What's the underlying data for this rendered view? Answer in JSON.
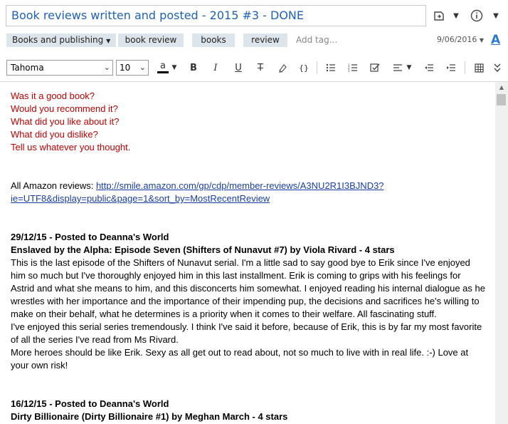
{
  "note": {
    "title": "Book reviews written and posted - 2015 #3 - DONE"
  },
  "header_icons": {
    "reminder": "reminder-icon",
    "info": "info-icon",
    "more": "more-icon"
  },
  "tags_bar": {
    "notebook": "Books and publishing",
    "tags": [
      "book review",
      "books",
      "review"
    ],
    "add_tag_placeholder": "Add tag...",
    "date": "9/06/2016",
    "font_icon": "A"
  },
  "toolbar": {
    "font": "Tahoma",
    "size": "10",
    "text_color_label": "a",
    "bold": "B",
    "italic": "I",
    "underline": "U",
    "strike": "T",
    "highlight_icon": "highlighter-icon",
    "code": "{}",
    "bullets_icon": "bulleted-list-icon",
    "numbered_icon": "numbered-list-icon",
    "checkbox_icon": "checkbox-icon",
    "align_icon": "align-icon",
    "outdent_icon": "outdent-icon",
    "indent_icon": "indent-icon",
    "table_icon": "table-icon",
    "expand_icon": "expand-chevron-icon"
  },
  "content": {
    "questions": [
      "Was it a good book?",
      "Would you recommend it?",
      "What did you like about it?",
      "What did you dislike?",
      "Tell us whatever you thought."
    ],
    "amazon_label": "All Amazon reviews: ",
    "amazon_link_1": "http://smile.amazon.com/gp/cdp/member-reviews/A3NU2R1I3BJND3?",
    "amazon_link_2": "ie=UTF8&display=public&page=1&sort_by=MostRecentReview",
    "review1": {
      "heading": "29/12/15 - Posted to Deanna's World",
      "book": "Enslaved by the Alpha: Episode Seven (Shifters of Nunavut #7) by Viola Rivard - 4 stars",
      "lines": [
        "This is the last episode of the Shifters of Nunavut serial. I'm a little sad to say good bye to Erik since I've enjoyed",
        "him so much but I've thoroughly enjoyed him in this last installment. Erik is coming to grips with his feelings for",
        "Astrid and what she means to him, and this disconcerts him somewhat. I enjoyed reading his internal dialogue as he",
        "wrestles with her importance and the importance of their impending pup, the decisions and sacrifices he's willing to",
        "make on their behalf, what he determines is a priority when it comes to their welfare. All fascinating stuff.",
        "I've enjoyed this serial series tremendously. I think I've said it before, because of Erik, this is by far my most favorite",
        "of all the series I've read from Ms Rivard.",
        "More heroes should be like Erik. Sexy as all get out to read about, not so much to live with in real life. :-) Love at",
        "your own risk!"
      ]
    },
    "review2": {
      "heading": "16/12/15 - Posted to Deanna's World",
      "book": "Dirty Billionaire (Dirty Billionaire #1) by Meghan March - 4 stars"
    }
  }
}
